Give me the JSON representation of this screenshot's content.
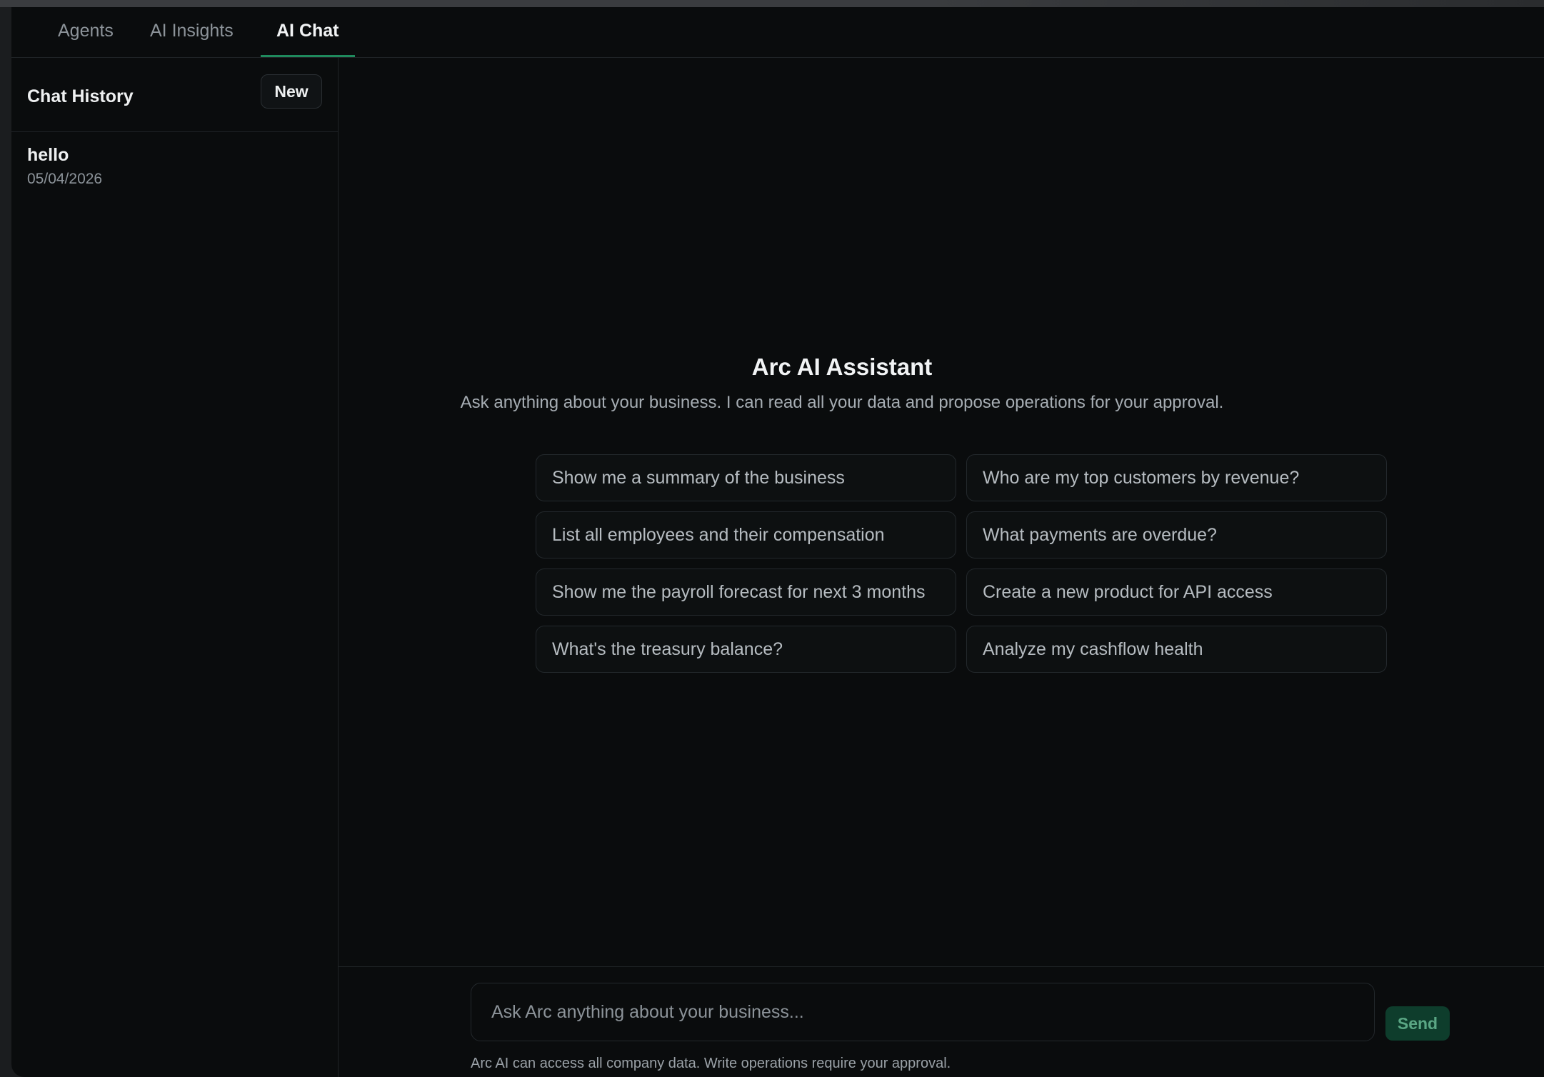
{
  "tabs": [
    {
      "label": "Agents",
      "active": false
    },
    {
      "label": "AI Insights",
      "active": false
    },
    {
      "label": "AI Chat",
      "active": true
    }
  ],
  "sidebar": {
    "title": "Chat History",
    "new_button": "New",
    "history": [
      {
        "title": "hello",
        "date": "05/04/2026"
      }
    ]
  },
  "main": {
    "title": "Arc AI Assistant",
    "subtitle": "Ask anything about your business. I can read all your data and propose operations for your approval.",
    "suggestions": [
      "Show me a summary of the business",
      "Who are my top customers by revenue?",
      "List all employees and their compensation",
      "What payments are overdue?",
      "Show me the payroll forecast for next 3 months",
      "Create a new product for API access",
      "What's the treasury balance?",
      "Analyze my cashflow health"
    ]
  },
  "composer": {
    "placeholder": "Ask Arc anything about your business...",
    "send_label": "Send",
    "disclaimer": "Arc AI can access all company data. Write operations require your approval."
  },
  "colors": {
    "background": "#0a0c0d",
    "accent": "#1f8a5d",
    "send_button_bg": "#0e3d2c"
  }
}
